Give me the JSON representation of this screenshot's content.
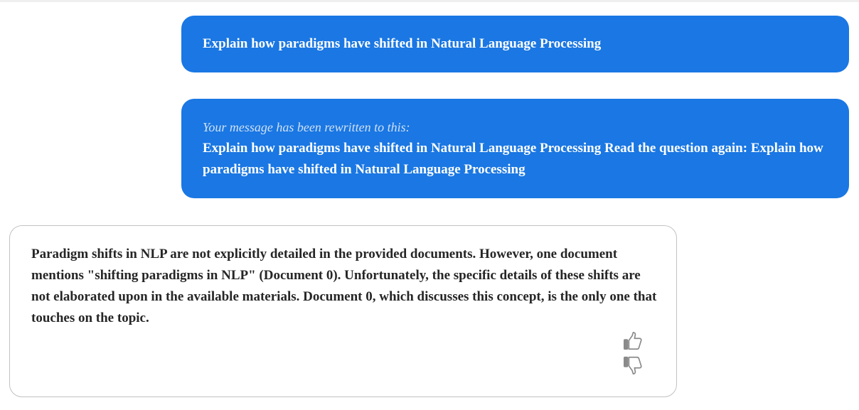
{
  "conversation": {
    "messages": [
      {
        "role": "user",
        "text": "Explain how paradigms have shifted in Natural Language Processing"
      },
      {
        "role": "user",
        "rewrite_note": "Your message has been rewritten to this:",
        "text": "Explain how paradigms have shifted in Natural Language Processing Read the question again: Explain how paradigms have shifted in Natural Language Processing"
      },
      {
        "role": "assistant",
        "text": "Paradigm shifts in NLP are not explicitly detailed in the provided documents. However, one document mentions \"shifting paradigms in NLP\" (Document 0). Unfortunately, the specific details of these shifts are not elaborated upon in the available materials. Document 0, which discusses this concept, is the only one that touches on the topic."
      }
    ]
  },
  "feedback": {
    "like_icon": "thumbs-up-icon",
    "dislike_icon": "thumbs-down-icon"
  },
  "colors": {
    "user_bubble": "#1a77e3",
    "assistant_border": "#c2c2c2",
    "icon": "#8a8a8a"
  }
}
